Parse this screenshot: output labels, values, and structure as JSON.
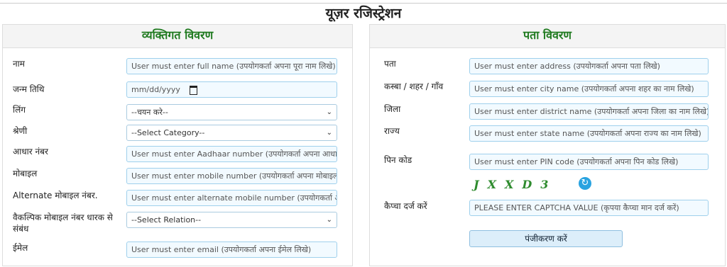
{
  "page": {
    "title": "यूज़र रजिस्ट्रेशन"
  },
  "personal": {
    "heading": "व्यक्तिगत विवरण",
    "name_label": "नाम",
    "name_placeholder": "User must enter full name (उपयोगकर्ता अपना पूरा नाम लिखे)",
    "dob_label": "जन्म तिथि",
    "dob_placeholder": "mm/dd/yyyy",
    "gender_label": "लिंग",
    "gender_selected": "--चयन करे--",
    "category_label": "श्रेणी",
    "category_selected": "--Select Category--",
    "aadhaar_label": "आधार नंबर",
    "aadhaar_placeholder": "User must enter Aadhaar number (उपयोगकर्ता अपना आधार नं",
    "mobile_label": "मोबाइल",
    "mobile_placeholder": "User must enter mobile number (उपयोगकर्ता अपना मोबाइल नं",
    "alt_mobile_label": "Alternate मोबाइल नंबर.",
    "alt_mobile_placeholder": "User must enter alternate mobile number (उपयोगकर्ता अपना",
    "relation_label": "वैकल्पिक मोबाइल नंबर धारक से संबंध",
    "relation_selected": "--Select Relation--",
    "email_label": "ईमेल",
    "email_placeholder": "User must enter email (उपयोगकर्ता अपना ईमेल लिखे)"
  },
  "address": {
    "heading": "पता विवरण",
    "address_label": "पता",
    "address_placeholder": "User must enter address (उपयोगकर्ता अपना पता लिखे)",
    "city_label": "कस्बा / शहर / गाँव",
    "city_placeholder": "User must enter city name (उपयोगकर्ता अपना शहर का नाम लिखे)",
    "district_label": "जिला",
    "district_placeholder": "User must enter district name (उपयोगकर्ता अपना जिला का नाम लिखे)",
    "state_label": "राज्य",
    "state_placeholder": "User must enter state name (उपयोगकर्ता अपना राज्य का नाम लिखे)",
    "pin_label": "पिन कोड",
    "pin_placeholder": "User must enter PIN code (उपयोगकर्ता अपना पिन कोड लिखे)",
    "captcha_text": "JXXD3",
    "captcha_label": "कैप्चा दर्ज करें",
    "captcha_placeholder": "PLEASE ENTER CAPTCHA VALUE (कृपया कैप्चा मान दर्ज करें)",
    "submit_label": "पंजीकरण करें"
  },
  "icons": {
    "refresh": "refresh-icon",
    "calendar": "calendar-icon",
    "dropdown": "chevron-down-icon"
  },
  "colors": {
    "heading_green": "#1f7a1f",
    "field_border": "#9fd0ec",
    "field_bg": "#f2faff",
    "button_bg": "#dceefa",
    "captcha_green": "#2e8b2e",
    "refresh_blue": "#29a3e0"
  }
}
